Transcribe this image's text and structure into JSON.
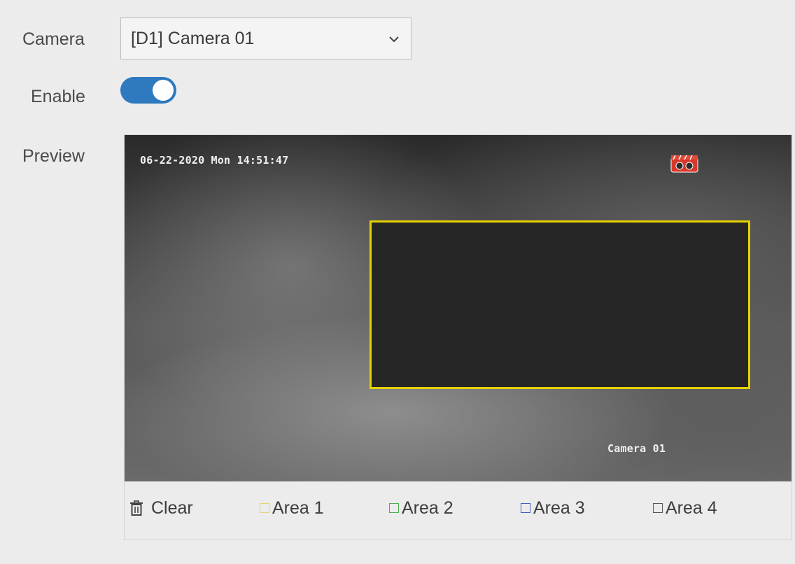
{
  "form": {
    "camera_label": "Camera",
    "camera_value": "[D1] Camera 01",
    "enable_label": "Enable",
    "enable_state": true,
    "preview_label": "Preview"
  },
  "preview": {
    "timestamp": "06-22-2020 Mon 14:51:47",
    "camera_name": "Camera 01",
    "record_icon": "recording-icon"
  },
  "toolbar": {
    "clear_label": "Clear",
    "clear_icon": "trash-icon",
    "areas": [
      {
        "label": "Area 1",
        "color": "#e6d27a"
      },
      {
        "label": "Area 2",
        "color": "#4caf50"
      },
      {
        "label": "Area 3",
        "color": "#3b5fbf"
      },
      {
        "label": "Area 4",
        "color": "#555555"
      }
    ]
  },
  "colors": {
    "toggle_on": "#2f79bf",
    "detection_area_border": "#e6d000",
    "background": "#ececec"
  }
}
